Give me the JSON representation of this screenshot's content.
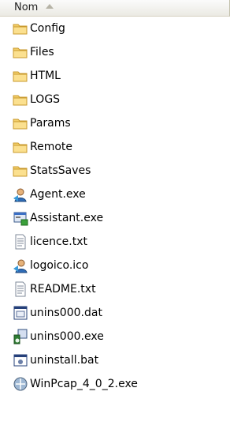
{
  "header": {
    "column": "Nom"
  },
  "files": [
    {
      "name": "Config",
      "icon": "folder-icon"
    },
    {
      "name": "Files",
      "icon": "folder-icon"
    },
    {
      "name": "HTML",
      "icon": "folder-icon"
    },
    {
      "name": "LOGS",
      "icon": "folder-icon"
    },
    {
      "name": "Params",
      "icon": "folder-icon"
    },
    {
      "name": "Remote",
      "icon": "folder-icon"
    },
    {
      "name": "StatsSaves",
      "icon": "folder-icon"
    },
    {
      "name": "Agent.exe",
      "icon": "agent-exe-icon"
    },
    {
      "name": "Assistant.exe",
      "icon": "assistant-exe-icon"
    },
    {
      "name": "licence.txt",
      "icon": "text-file-icon"
    },
    {
      "name": "logoico.ico",
      "icon": "ico-file-icon"
    },
    {
      "name": "README.txt",
      "icon": "text-file-icon"
    },
    {
      "name": "unins000.dat",
      "icon": "dat-file-icon"
    },
    {
      "name": "unins000.exe",
      "icon": "installer-exe-icon"
    },
    {
      "name": "uninstall.bat",
      "icon": "bat-file-icon"
    },
    {
      "name": "WinPcap_4_0_2.exe",
      "icon": "winpcap-exe-icon"
    }
  ]
}
